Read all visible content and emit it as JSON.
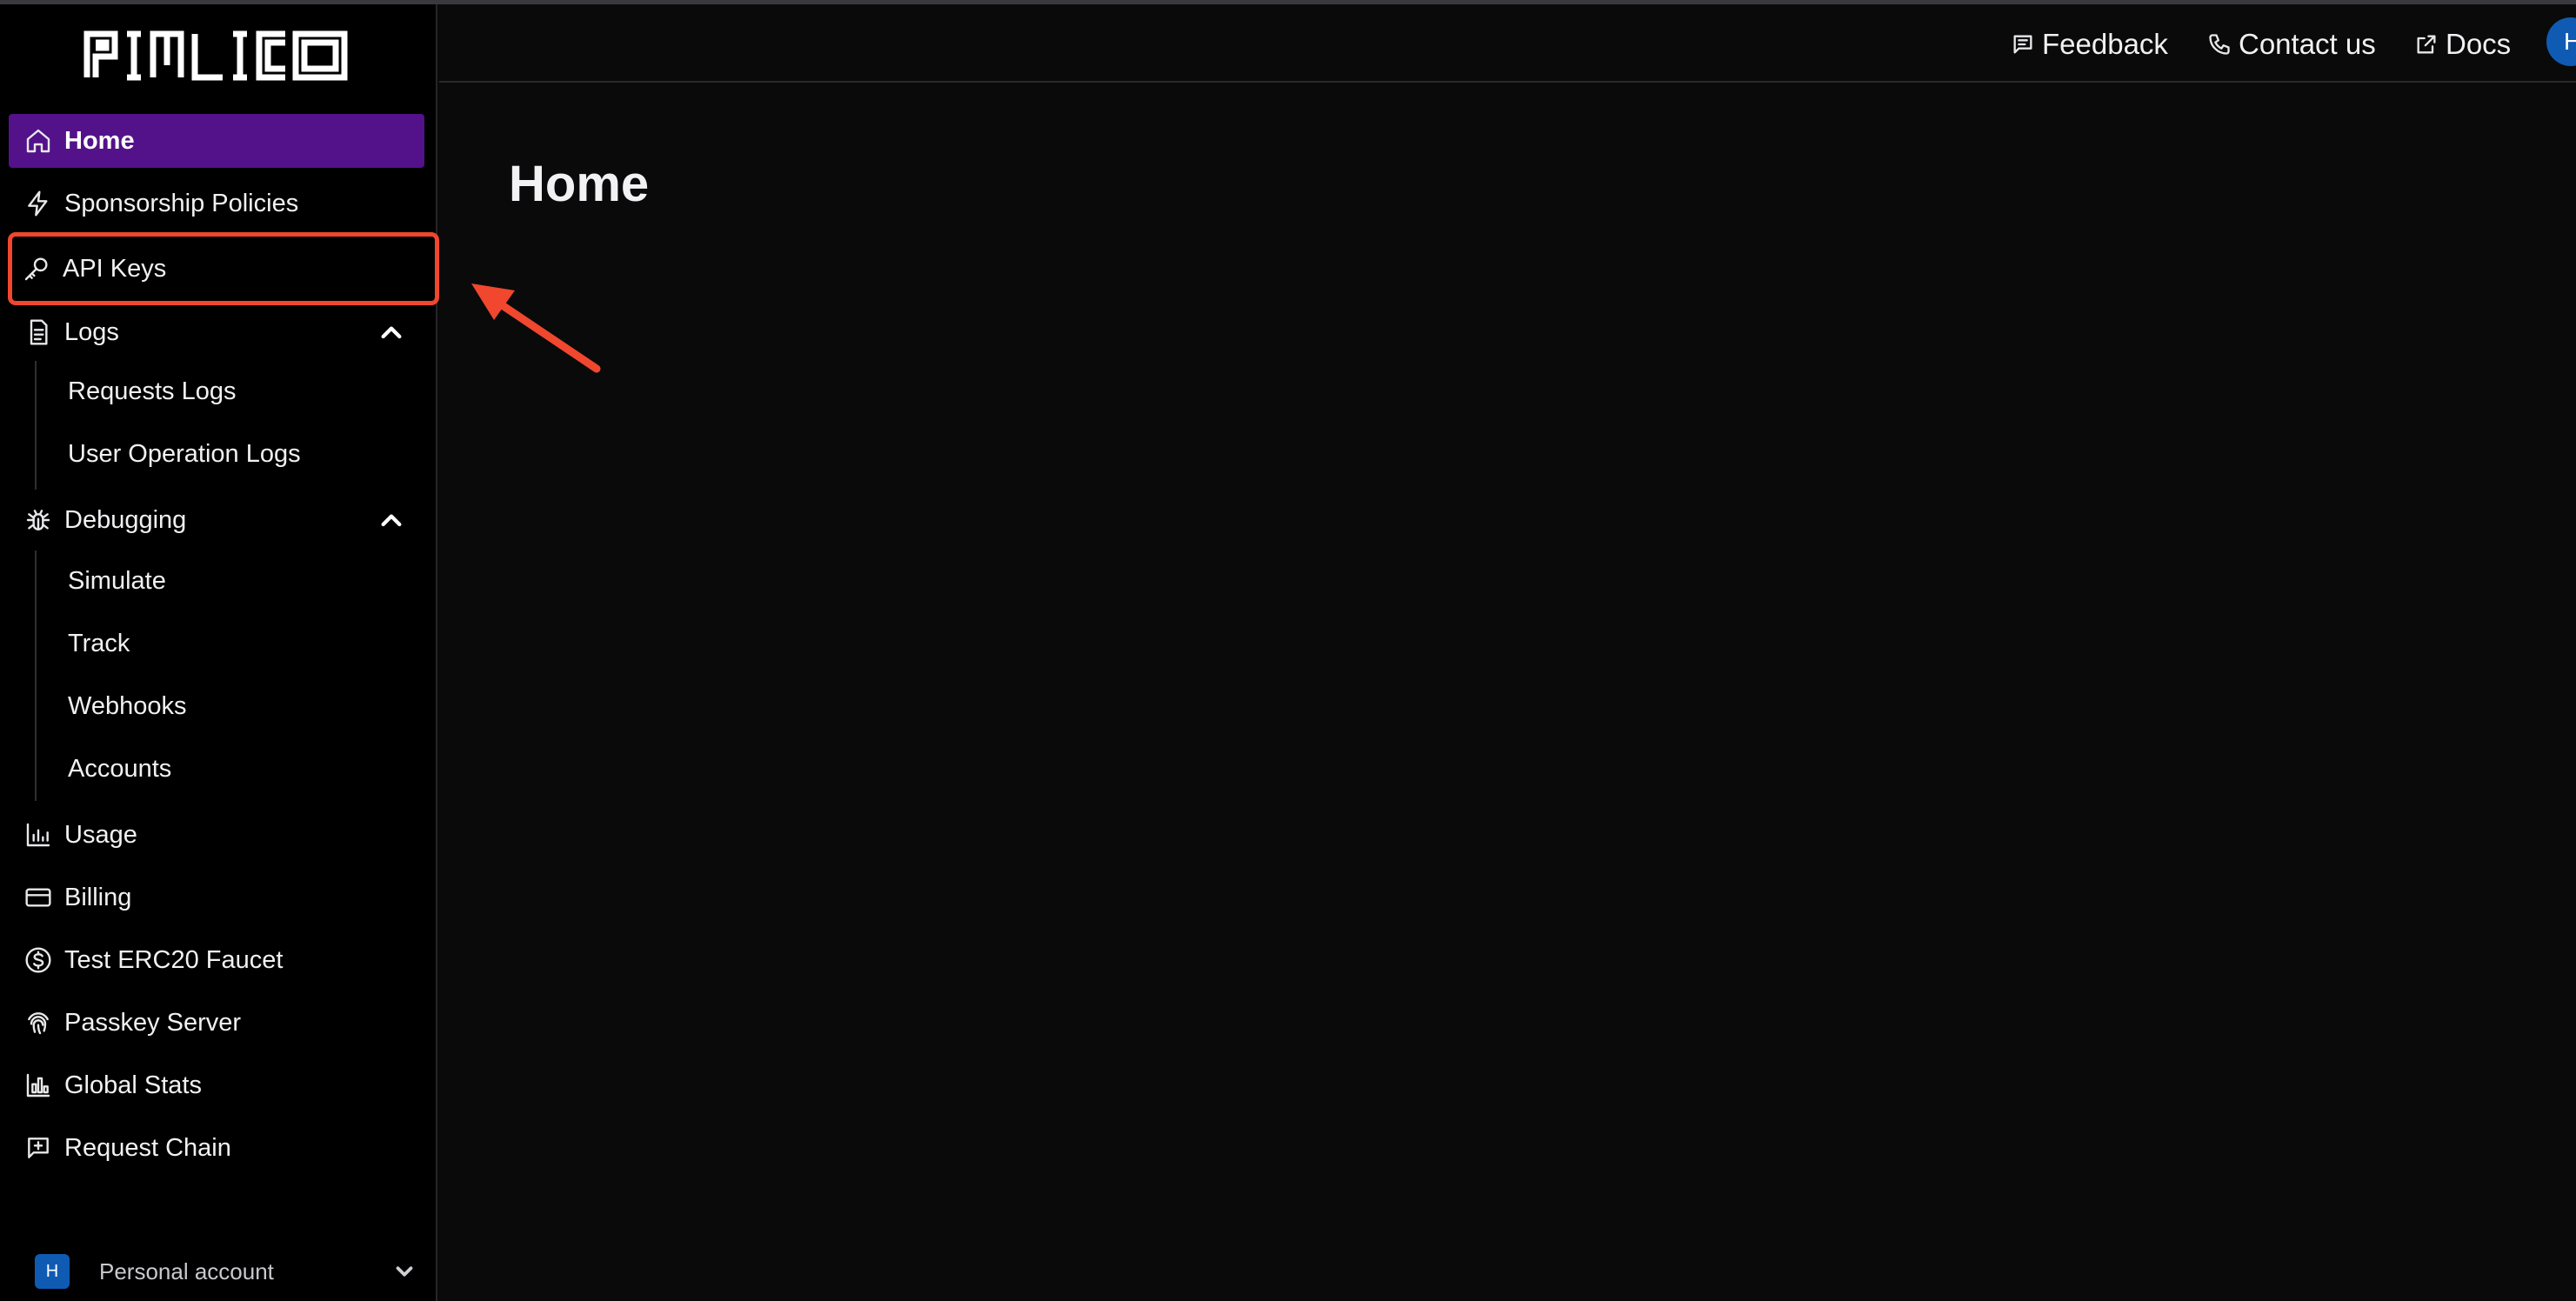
{
  "brand": {
    "logo_text": "PIMLICO"
  },
  "sidebar": {
    "items": [
      {
        "label": "Home",
        "icon": "home-icon"
      },
      {
        "label": "Sponsorship Policies",
        "icon": "lightning-icon"
      },
      {
        "label": "API Keys",
        "icon": "key-icon"
      },
      {
        "label": "Logs",
        "icon": "document-icon"
      },
      {
        "label": "Debugging",
        "icon": "bug-icon"
      },
      {
        "label": "Usage",
        "icon": "bar-chart-icon"
      },
      {
        "label": "Billing",
        "icon": "credit-card-icon"
      },
      {
        "label": "Test ERC20 Faucet",
        "icon": "dollar-circle-icon"
      },
      {
        "label": "Passkey Server",
        "icon": "fingerprint-icon"
      },
      {
        "label": "Global Stats",
        "icon": "stats-icon"
      },
      {
        "label": "Request Chain",
        "icon": "message-plus-icon"
      }
    ],
    "logs_children": [
      "Requests Logs",
      "User Operation Logs"
    ],
    "debugging_children": [
      "Simulate",
      "Track",
      "Webhooks",
      "Accounts"
    ],
    "account": {
      "avatar_letter": "H",
      "label": "Personal account"
    }
  },
  "topbar": {
    "feedback": "Feedback",
    "contact": "Contact us",
    "docs": "Docs",
    "user_initial": "H"
  },
  "main": {
    "title": "Home"
  },
  "colors": {
    "active_bg": "#53118a",
    "highlight": "#f0472e",
    "avatar": "#0f5bb3",
    "background": "#0a0a0a"
  }
}
